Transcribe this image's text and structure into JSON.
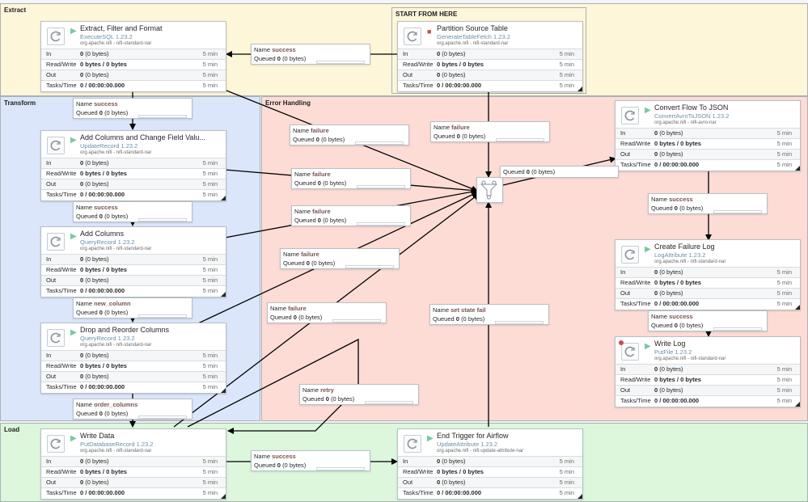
{
  "groups": {
    "extract": "Extract",
    "start": "START FROM HERE",
    "transform": "Transform",
    "error": "Error Handling",
    "load": "Load"
  },
  "labels": {
    "in": "In",
    "rw": "Read/Write",
    "out": "Out",
    "tasks": "Tasks/Time",
    "name": "Name",
    "queued": "Queued"
  },
  "colors": {
    "extract_bg": "#fdf6d9",
    "transform_bg": "#dbe6fb",
    "error_bg": "#fddcd5",
    "load_bg": "#dcf7dc",
    "running": "#7dc7a0",
    "stopped": "#c24f4f"
  },
  "processors": [
    {
      "name": "Extract, Filter and Format",
      "type": "ExecuteSQL 1.23.2",
      "bundle": "org.apache.nifi - nifi-standard-nar",
      "state": "running",
      "in_n": "0",
      "in_b": "(0 bytes)",
      "rw": "0 bytes / 0 bytes",
      "out_n": "0",
      "out_b": "(0 bytes)",
      "tasks": "0 / 00:00:00.000",
      "t1": "5 min",
      "t2": "5 min",
      "t3": "5 min",
      "t4": "5 min"
    },
    {
      "name": "Partition Source Table",
      "type": "GenerateTableFetch 1.23.2",
      "bundle": "org.apache.nifi - nifi-standard-nar",
      "state": "stopped",
      "in_n": "0",
      "in_b": "(0 bytes)",
      "rw": "0 bytes / 0 bytes",
      "out_n": "0",
      "out_b": "(0 bytes)",
      "tasks": "0 / 00:00:00.000",
      "t1": "5 min",
      "t2": "5 min",
      "t3": "5 min",
      "t4": "5 min"
    },
    {
      "name": "Add Columns and Change Field Valu...",
      "type": "UpdateRecord 1.23.2",
      "bundle": "org.apache.nifi - nifi-standard-nar",
      "state": "running",
      "in_n": "0",
      "in_b": "(0 bytes)",
      "rw": "0 bytes / 0 bytes",
      "out_n": "0",
      "out_b": "(0 bytes)",
      "tasks": "0 / 00:00:00.000",
      "t1": "5 min",
      "t2": "5 min",
      "t3": "5 min",
      "t4": "5 min"
    },
    {
      "name": "Add Columns",
      "type": "QueryRecord 1.23.2",
      "bundle": "org.apache.nifi - nifi-standard-nar",
      "state": "running",
      "in_n": "0",
      "in_b": "(0 bytes)",
      "rw": "0 bytes / 0 bytes",
      "out_n": "0",
      "out_b": "(0 bytes)",
      "tasks": "0 / 00:00:00.000",
      "t1": "5 min",
      "t2": "5 min",
      "t3": "5 min",
      "t4": "5 min"
    },
    {
      "name": "Drop and Reorder Columns",
      "type": "QueryRecord 1.23.2",
      "bundle": "org.apache.nifi - nifi-standard-nar",
      "state": "running",
      "in_n": "0",
      "in_b": "(0 bytes)",
      "rw": "0 bytes / 0 bytes",
      "out_n": "0",
      "out_b": "(0 bytes)",
      "tasks": "0 / 00:00:00.000",
      "t1": "5 min",
      "t2": "5 min",
      "t3": "5 min",
      "t4": "5 min"
    },
    {
      "name": "Write Data",
      "type": "PutDatabaseRecord 1.23.2",
      "bundle": "org.apache.nifi - nifi-standard-nar",
      "state": "running",
      "in_n": "0",
      "in_b": "(0 bytes)",
      "rw": "0 bytes / 0 bytes",
      "out_n": "0",
      "out_b": "(0 bytes)",
      "tasks": "0 / 00:00:00.000",
      "t1": "5 min",
      "t2": "5 min",
      "t3": "5 min",
      "t4": "5 min"
    },
    {
      "name": "End Trigger for Airflow",
      "type": "UpdateAttribute 1.23.2",
      "bundle": "org.apache.nifi - nifi-update-attribute-nar",
      "state": "running",
      "in_n": "0",
      "in_b": "(0 bytes)",
      "rw": "0 bytes / 0 bytes",
      "out_n": "0",
      "out_b": "(0 bytes)",
      "tasks": "0 / 00:00:00.000",
      "t1": "5 min",
      "t2": "5 min",
      "t3": "5 min",
      "t4": "5 min"
    },
    {
      "name": "Convert Flow To JSON",
      "type": "ConvertAvroToJSON 1.23.2",
      "bundle": "org.apache.nifi - nifi-avro-nar",
      "state": "running",
      "in_n": "0",
      "in_b": "(0 bytes)",
      "rw": "0 bytes / 0 bytes",
      "out_n": "0",
      "out_b": "(0 bytes)",
      "tasks": "0 / 00:00:00.000",
      "t1": "5 min",
      "t2": "5 min",
      "t3": "5 min",
      "t4": "5 min"
    },
    {
      "name": "Create Failure Log",
      "type": "LogAttribute 1.23.2",
      "bundle": "org.apache.nifi - nifi-standard-nar",
      "state": "running",
      "in_n": "0",
      "in_b": "(0 bytes)",
      "rw": "0 bytes / 0 bytes",
      "out_n": "0",
      "out_b": "(0 bytes)",
      "tasks": "0 / 00:00:00.000",
      "t1": "5 min",
      "t2": "5 min",
      "t3": "5 min",
      "t4": "5 min"
    },
    {
      "name": "Write Log",
      "type": "PutFile 1.23.2",
      "bundle": "org.apache.nifi - nifi-standard-nar",
      "state": "running",
      "in_n": "0",
      "in_b": "(0 bytes)",
      "rw": "0 bytes / 0 bytes",
      "out_n": "0",
      "out_b": "(0 bytes)",
      "tasks": "0 / 00:00:00.000",
      "t1": "5 min",
      "t2": "5 min",
      "t3": "5 min",
      "t4": "5 min"
    }
  ],
  "connections": [
    {
      "name": "success",
      "queued_n": "0",
      "queued_b": "(0 bytes)"
    },
    {
      "name": "success",
      "queued_n": "0",
      "queued_b": "(0 bytes)"
    },
    {
      "name": "success",
      "queued_n": "0",
      "queued_b": "(0 bytes)"
    },
    {
      "name": "new_column",
      "queued_n": "0",
      "queued_b": "(0 bytes)"
    },
    {
      "name": "order_columns",
      "queued_n": "0",
      "queued_b": "(0 bytes)"
    },
    {
      "name": "success",
      "queued_n": "0",
      "queued_b": "(0 bytes)"
    },
    {
      "name": "failure",
      "queued_n": "0",
      "queued_b": "(0 bytes)"
    },
    {
      "name": "failure",
      "queued_n": "0",
      "queued_b": "(0 bytes)"
    },
    {
      "name": "failure",
      "queued_n": "0",
      "queued_b": "(0 bytes)"
    },
    {
      "name": "failure",
      "queued_n": "0",
      "queued_b": "(0 bytes)"
    },
    {
      "name": "failure",
      "queued_n": "0",
      "queued_b": "(0 bytes)"
    },
    {
      "name": "failure",
      "queued_n": "0",
      "queued_b": "(0 bytes)"
    },
    {
      "name": "retry",
      "queued_n": "0",
      "queued_b": "(0 bytes)"
    },
    {
      "name": "set state fail",
      "queued_n": "0",
      "queued_b": "(0 bytes)"
    },
    {
      "name": "success",
      "queued_n": "0",
      "queued_b": "(0 bytes)"
    },
    {
      "name": "success",
      "queued_n": "0",
      "queued_b": "(0 bytes)"
    }
  ],
  "funnel_queue": {
    "label": "Queued",
    "n": "0",
    "b": "(0 bytes)"
  }
}
